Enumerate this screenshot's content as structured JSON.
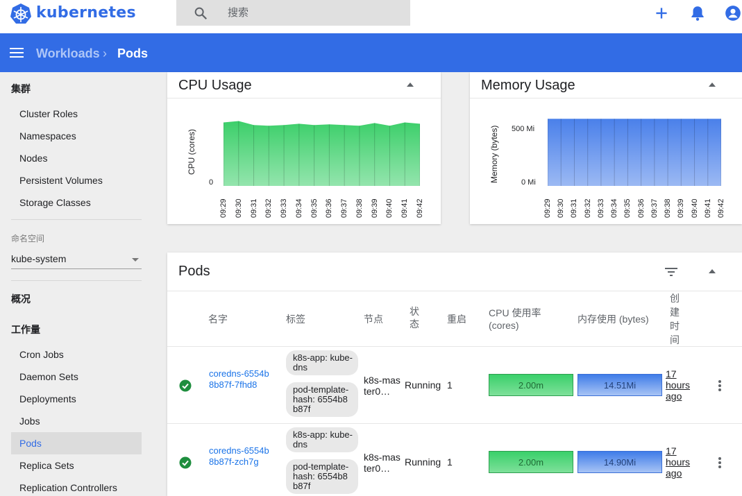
{
  "header": {
    "brand": "kubernetes",
    "search_placeholder": "搜索"
  },
  "appbar": {
    "breadcrumb_parent": "Workloads",
    "breadcrumb_sep": "›",
    "breadcrumb_current": "Pods"
  },
  "sidebar": {
    "cluster_heading": "集群",
    "cluster_items": [
      "Cluster Roles",
      "Namespaces",
      "Nodes",
      "Persistent Volumes",
      "Storage Classes"
    ],
    "namespace_label": "命名空间",
    "namespace_value": "kube-system",
    "overview_heading": "概况",
    "workloads_heading": "工作量",
    "workload_items": [
      "Cron Jobs",
      "Daemon Sets",
      "Deployments",
      "Jobs",
      "Pods",
      "Replica Sets",
      "Replication Controllers"
    ],
    "active_item": "Pods"
  },
  "cpu_card": {
    "title": "CPU Usage"
  },
  "memory_card": {
    "title": "Memory Usage"
  },
  "chart_data": [
    {
      "type": "area",
      "title": "CPU Usage",
      "ylabel": "CPU (cores)",
      "y_ticks": [
        "0"
      ],
      "x": [
        "09:29",
        "09:30",
        "09:31",
        "09:32",
        "09:33",
        "09:34",
        "09:35",
        "09:36",
        "09:37",
        "09:38",
        "09:39",
        "09:40",
        "09:41",
        "09:42"
      ],
      "series": [
        {
          "values": [
            0.95,
            0.97,
            0.91,
            0.9,
            0.91,
            0.93,
            0.91,
            0.92,
            0.91,
            0.9,
            0.94,
            0.9,
            0.95,
            0.93
          ]
        }
      ],
      "color": "#3ccf6a",
      "ylim": [
        0,
        1.1
      ]
    },
    {
      "type": "area",
      "title": "Memory Usage",
      "ylabel": "Memory (bytes)",
      "y_ticks": [
        "500 Mi",
        "0 Mi"
      ],
      "x": [
        "09:29",
        "09:30",
        "09:31",
        "09:32",
        "09:33",
        "09:34",
        "09:35",
        "09:36",
        "09:37",
        "09:38",
        "09:39",
        "09:40",
        "09:41",
        "09:42"
      ],
      "series": [
        {
          "values": [
            548,
            548,
            548,
            548,
            548,
            548,
            548,
            548,
            548,
            548,
            548,
            548,
            548,
            548
          ]
        }
      ],
      "color": "#4a80ea",
      "ylim": [
        0,
        600
      ]
    }
  ],
  "pods_card": {
    "title": "Pods",
    "columns": [
      "名字",
      "标签",
      "节点",
      "状态",
      "重启",
      "CPU 使用率 (cores)",
      "内存使用 (bytes)",
      "创建时间"
    ],
    "rows": [
      {
        "name": "coredns-6554b8b87f-7fhd8",
        "labels": [
          "k8s-app: kube-dns",
          "pod-template-hash: 6554b8b87f"
        ],
        "node": "k8s-master0…",
        "status": "Running",
        "restarts": "1",
        "cpu": "2.00m",
        "memory": "14.51Mi",
        "age": "17 hours ago"
      },
      {
        "name": "coredns-6554b8b87f-zch7g",
        "labels": [
          "k8s-app: kube-dns",
          "pod-template-hash: 6554b8b87f"
        ],
        "node": "k8s-master0…",
        "status": "Running",
        "restarts": "1",
        "cpu": "2.00m",
        "memory": "14.90Mi",
        "age": "17 hours ago"
      }
    ]
  },
  "colors": {
    "brand": "#326ce5",
    "running": "#1e8e3e",
    "link": "#1a73e8"
  }
}
